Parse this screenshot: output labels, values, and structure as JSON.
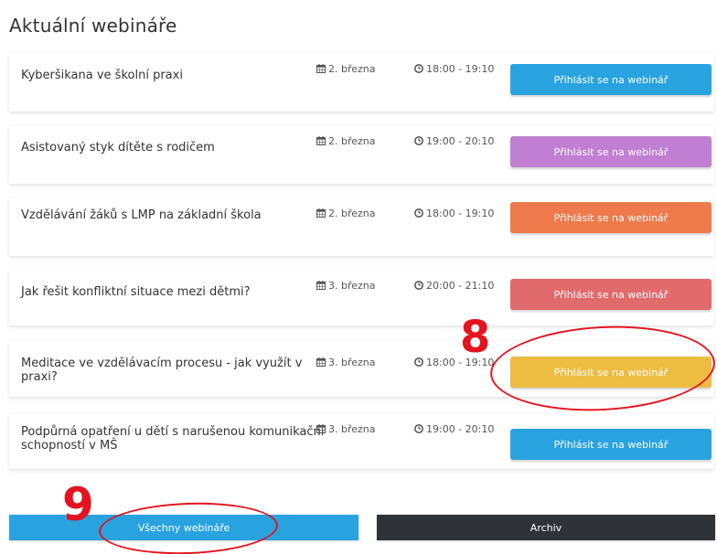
{
  "page_title": "Aktuální webináře",
  "register_label": "Přihlásit se na webinář",
  "webinars": [
    {
      "title": "Kyberšikana ve školní praxi",
      "date": "2. března",
      "time": "18:00 - 19:10",
      "color": "#29a3e0"
    },
    {
      "title": "Asistovaný styk dítěte s rodičem",
      "date": "2. března",
      "time": "19:00 - 20:10",
      "color": "#c17fd3"
    },
    {
      "title": "Vzdělávání žáků s LMP na základní škola",
      "date": "2. března",
      "time": "18:00 - 19:10",
      "color": "#ef7a4b"
    },
    {
      "title": "Jak řešit konfliktní situace mezi dětmi?",
      "date": "3. března",
      "time": "20:00 - 21:10",
      "color": "#e06a6c"
    },
    {
      "title": "Meditace ve vzdělávacím procesu - jak využít v praxi?",
      "date": "3. března",
      "time": "18:00 - 19:10",
      "color": "#edbd42"
    },
    {
      "title": "Podpůrná opatření u dětí s narušenou komunikační schopností v MŠ",
      "date": "3. března",
      "time": "19:00 - 20:10",
      "color": "#29a3e0"
    }
  ],
  "footer": {
    "all_webinars_label": "Všechny webináře",
    "archive_label": "Archiv"
  },
  "annotations": [
    {
      "number": "8",
      "color": "#e3141f"
    },
    {
      "number": "9",
      "color": "#e3141f"
    }
  ]
}
